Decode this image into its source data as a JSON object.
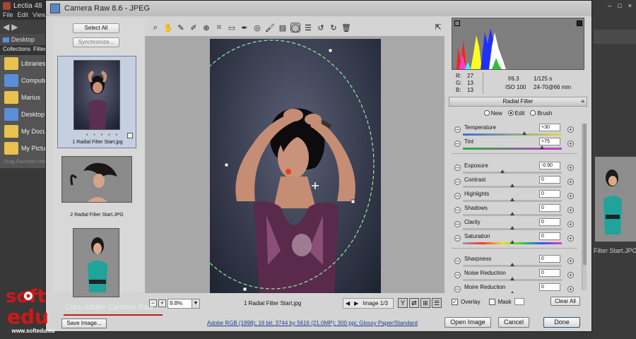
{
  "background_app": {
    "title": "Lectia 48",
    "menu": [
      "File",
      "Edit",
      "View"
    ],
    "breadcrumb": "Desktop",
    "panel_tabs": [
      "Collections",
      "Filter"
    ],
    "favorites": [
      {
        "label": "Libraries",
        "icon": "libraries-folder-icon"
      },
      {
        "label": "Computer",
        "icon": "computer-icon"
      },
      {
        "label": "Marius",
        "icon": "user-folder-icon"
      },
      {
        "label": "Desktop",
        "icon": "desktop-icon"
      },
      {
        "label": "My Documents",
        "icon": "documents-folder-icon"
      },
      {
        "label": "My Pictures",
        "icon": "pictures-folder-icon"
      }
    ],
    "drag_hint": "Drag Favorites Here",
    "right_caption": "Filter Start.JPG",
    "window_controls": [
      "–",
      "□",
      "×"
    ]
  },
  "dialog": {
    "title": "Camera Raw 8.6  -  JPEG",
    "filmstrip": {
      "select_all": "Select All",
      "synchronize": "Synchronize...",
      "thumbnails": [
        {
          "label": "1 Radial Filter Start.jpg",
          "selected": true,
          "rating_dots": "• • • • •"
        },
        {
          "label": "2 Radial Filter Start.JPG",
          "selected": false
        },
        {
          "label": "",
          "selected": false
        }
      ]
    },
    "tools": [
      "zoom-icon",
      "hand-icon",
      "white-balance-icon",
      "color-sampler-icon",
      "targeted-adjustment-icon",
      "crop-icon",
      "straighten-icon",
      "spot-removal-icon",
      "red-eye-icon",
      "adjustment-brush-icon",
      "graduated-filter-icon",
      "radial-filter-icon",
      "preferences-icon",
      "rotate-left-icon",
      "rotate-right-icon",
      "trash-icon"
    ],
    "active_tool": "radial-filter-icon",
    "statusbar": {
      "zoom": "9.8%",
      "filename": "1 Radial Filter Start.jpg",
      "image_counter": "Image 1/3"
    },
    "info": {
      "r_label": "R:",
      "r": "27",
      "g_label": "G:",
      "g": "13",
      "b_label": "B:",
      "b": "13",
      "aperture": "f/6.3",
      "shutter": "1/125 s",
      "iso": "ISO 100",
      "lens": "24-70@66 mm"
    },
    "panel": {
      "title": "Radial Filter",
      "modes": [
        "New",
        "Edit",
        "Brush"
      ],
      "selected_mode": "Edit",
      "sliders": [
        {
          "label": "Temperature",
          "value": "+30",
          "position": 0.62,
          "track": "temp"
        },
        {
          "label": "Tint",
          "value": "+75",
          "position": 0.8,
          "track": "tint"
        },
        {
          "label": "Exposure",
          "value": "-0.90",
          "position": 0.4,
          "track": "plain"
        },
        {
          "label": "Contrast",
          "value": "0",
          "position": 0.5,
          "track": "plain"
        },
        {
          "label": "Highlights",
          "value": "0",
          "position": 0.5,
          "track": "plain"
        },
        {
          "label": "Shadows",
          "value": "0",
          "position": 0.5,
          "track": "plain"
        },
        {
          "label": "Clarity",
          "value": "0",
          "position": 0.5,
          "track": "plain"
        },
        {
          "label": "Saturation",
          "value": "0",
          "position": 0.5,
          "track": "sat"
        },
        {
          "label": "Sharpness",
          "value": "0",
          "position": 0.5,
          "track": "plain"
        },
        {
          "label": "Noise Reduction",
          "value": "0",
          "position": 0.5,
          "track": "plain"
        },
        {
          "label": "Moire Reduction",
          "value": "0",
          "position": 0.5,
          "track": "plain"
        }
      ],
      "overlay_label": "Overlay",
      "overlay_checked": true,
      "mask_label": "Mask",
      "mask_checked": false,
      "clear_all": "Clear All"
    },
    "save_image": "Save Image...",
    "workflow_link": "Adobe RGB (1998); 16 bit; 3744 by 5616 (21.0MP); 300 ppi; Glossy Paper/Standard",
    "open_image": "Open Image",
    "cancel": "Cancel",
    "done": "Done"
  },
  "watermark": {
    "logo_lines": [
      "soft",
      "edu"
    ],
    "caption": "Curs Adobe Camera Raw",
    "url": "www.softedu.eu"
  },
  "colors": {
    "accent_blue": "#1d3e8c",
    "selection_ellipse": "#8ef0a0",
    "pin_red": "#e8411f",
    "watermark_red": "#c01c1c"
  }
}
